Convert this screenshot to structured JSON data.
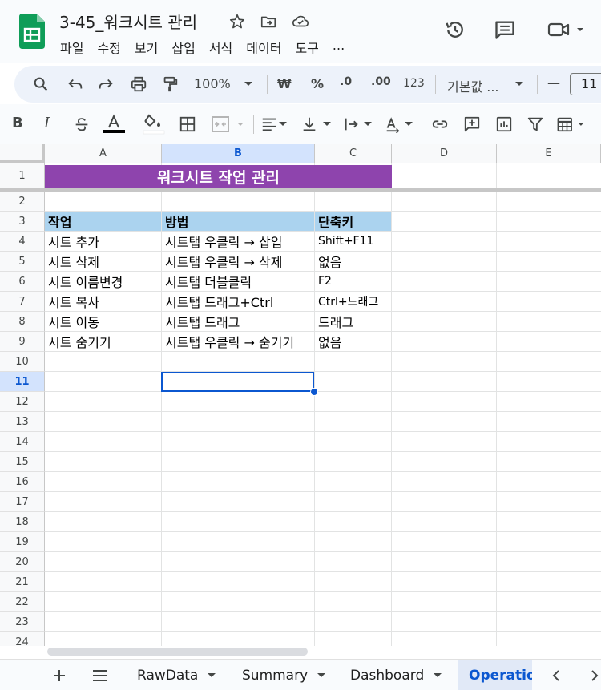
{
  "app": {
    "doc_title": "3-45_워크시트 관리"
  },
  "menu": [
    "파일",
    "수정",
    "보기",
    "삽입",
    "서식",
    "데이터",
    "도구",
    "..."
  ],
  "toolbar": {
    "zoom": "100%",
    "currency": "₩",
    "percent": "%",
    "decrease_decimal": ".0",
    "increase_decimal": ".00",
    "format_123": "123",
    "font": "기본값 ...",
    "font_size": "11",
    "minus": "—"
  },
  "columns": [
    "A",
    "B",
    "C",
    "D",
    "E"
  ],
  "selected_column": "B",
  "rows": [
    "1",
    "2",
    "3",
    "4",
    "5",
    "6",
    "7",
    "8",
    "9",
    "10",
    "11",
    "12",
    "13",
    "14",
    "15",
    "16",
    "17",
    "18",
    "19",
    "20",
    "21",
    "22",
    "23",
    "24"
  ],
  "selected_row": "11",
  "sheet": {
    "title": "워크시트 작업 관리",
    "headers": [
      "작업",
      "방법",
      "단축키"
    ],
    "data": [
      [
        "시트 추가",
        "시트탭 우클릭 → 삽입",
        "Shift+F11"
      ],
      [
        "시트 삭제",
        "시트탭 우클릭 → 삭제",
        "없음"
      ],
      [
        "시트 이름변경",
        "시트탭 더블클릭",
        "F2"
      ],
      [
        "시트 복사",
        "시트탭 드래그+Ctrl",
        "Ctrl+드래그"
      ],
      [
        "시트 이동",
        "시트탭 드래그",
        "드래그"
      ],
      [
        "시트 숨기기",
        "시트탭 우클릭 → 숨기기",
        "없음"
      ]
    ]
  },
  "sheet_tabs": [
    {
      "label": "RawData"
    },
    {
      "label": "Summary"
    },
    {
      "label": "Dashboard"
    },
    {
      "label": "Operatio"
    }
  ],
  "colors": {
    "title_fill": "#8e44ad",
    "header_fill": "#abd3ef",
    "selection": "#0b57d0",
    "sheets_green": "#0f9d58"
  }
}
